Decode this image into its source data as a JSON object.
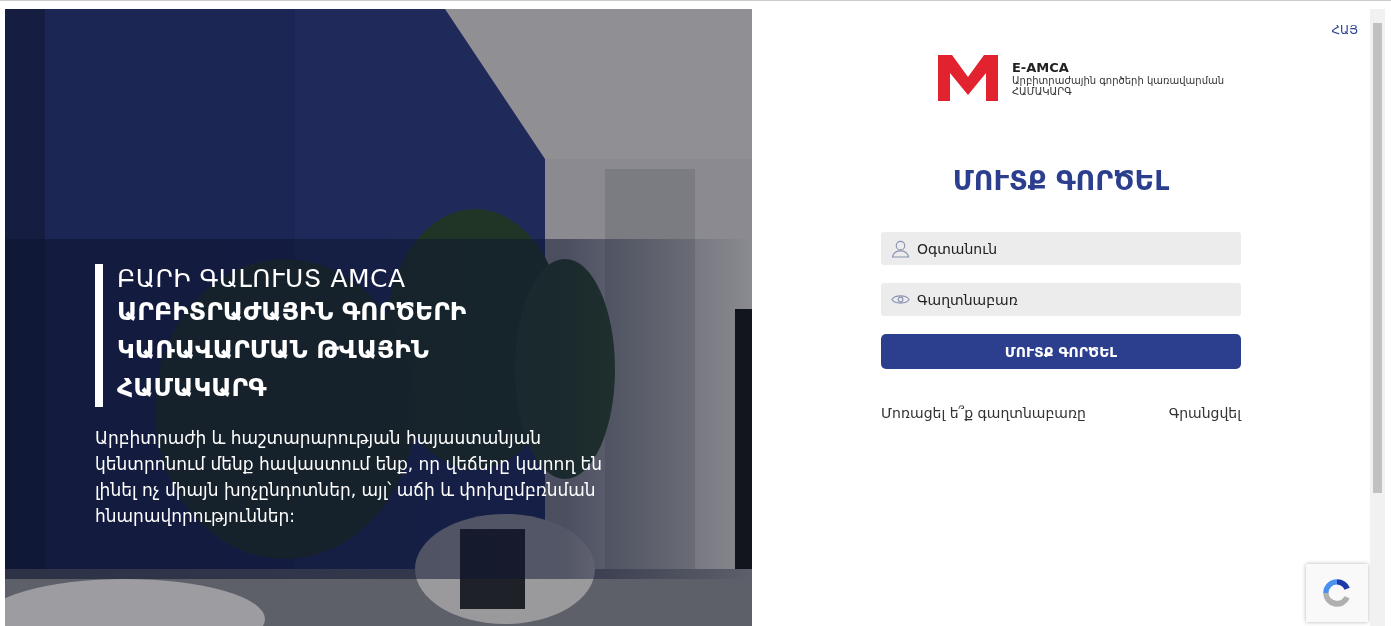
{
  "hero": {
    "kind": "picture",
    "greeting": "ԲԱՐԻ ԳԱԼՈՒՍՏ AMCA",
    "headline": "ԱՐԲԻՏՐԱԺԱՅԻՆ ԳՈՐԾԵՐԻ ԿԱՌԱՎԱՐՄԱՆ ԹՎԱՅԻՆ ՀԱՄԱԿԱՐԳ",
    "text": "Արբիտրաժի և հաշտարարության հայաստանյան կենտրոնում մենք հավաստում ենք, որ վեճերը կարող են լինել ոչ միայն խոչընդոտներ, այլ՝ աճի և փոխըմբռնման հնարավորություններ:"
  },
  "language": "ՀԱՅ",
  "logo": {
    "name": "E-AMCA",
    "subtitle": "Արբիտրաժային գործերի կառավարման",
    "subtitle_2": "ՀԱՄԱԿԱՐԳ"
  },
  "login": {
    "title": "ՄՈՒՏՔ ԳՈՐԾԵԼ",
    "fields": [
      {
        "kind": "user",
        "placeholder": "Օգտանուն"
      },
      {
        "kind": "password",
        "placeholder": "Գաղտնաբառ"
      }
    ],
    "button": "ՄՈՒՏՔ ԳՈՐԾԵԼ",
    "forgot": "Մոռացել ե՞ք գաղտնաբառը",
    "register": "Գրանցվել"
  }
}
